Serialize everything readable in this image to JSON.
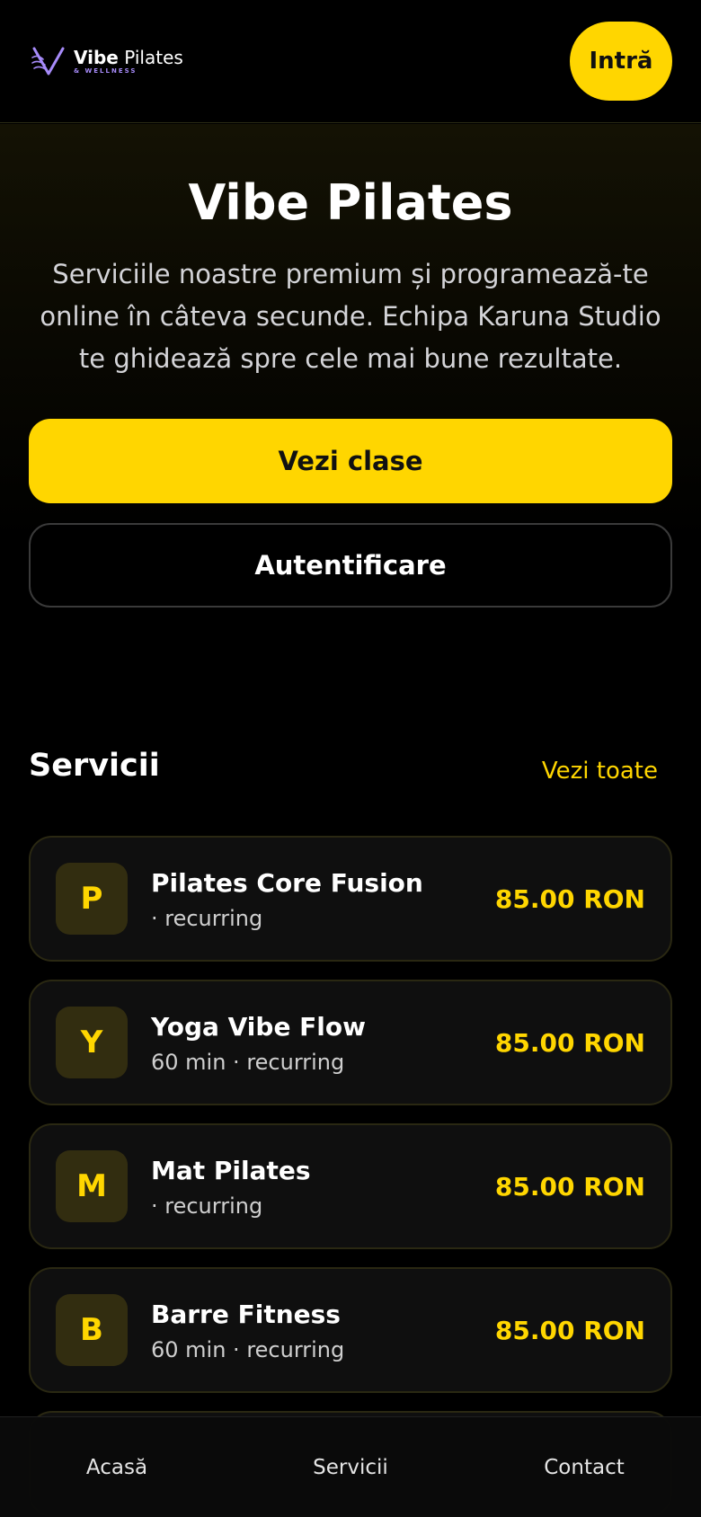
{
  "header": {
    "logo_main_bold": "Vibe",
    "logo_main_light": "Pilates",
    "logo_sub": "& WELLNESS",
    "enter_label": "Intră"
  },
  "hero": {
    "title": "Vibe Pilates",
    "subtitle": "Serviciile noastre premium și programează-te online în câteva secunde. Echipa Karuna Studio te ghidează spre cele mai bune rezultate.",
    "primary_label": "Vezi clase",
    "secondary_label": "Autentificare"
  },
  "services": {
    "title": "Servicii",
    "see_all": "Vezi toate",
    "items": [
      {
        "initial": "P",
        "name": "Pilates Core Fusion",
        "meta": "· recurring",
        "price": "85.00 RON"
      },
      {
        "initial": "Y",
        "name": "Yoga Vibe Flow",
        "meta": "60 min · recurring",
        "price": "85.00 RON"
      },
      {
        "initial": "M",
        "name": "Mat Pilates",
        "meta": "· recurring",
        "price": "85.00 RON"
      },
      {
        "initial": "B",
        "name": "Barre Fitness",
        "meta": "60 min · recurring",
        "price": "85.00 RON"
      }
    ]
  },
  "nav": {
    "home": "Acasă",
    "services": "Servicii",
    "contact": "Contact"
  },
  "colors": {
    "accent": "#ffd600",
    "logo_purple": "#a78bfa",
    "background": "#000000"
  }
}
